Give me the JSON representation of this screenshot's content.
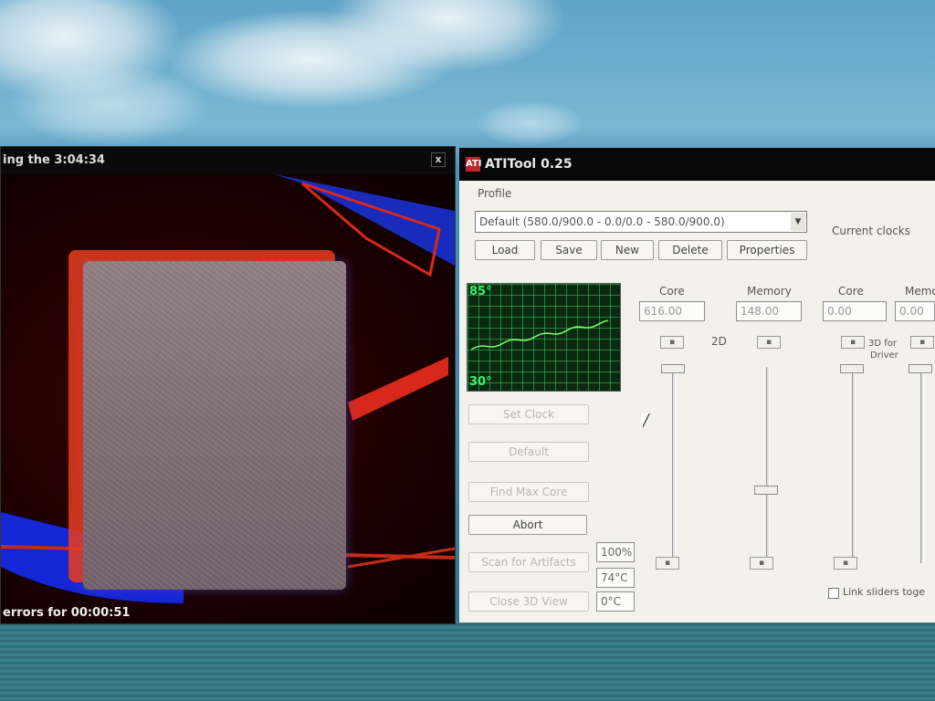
{
  "view_window": {
    "title": "ing the 3:04:34",
    "close_glyph": "x",
    "status": "errors for 00:00:51"
  },
  "ati_window": {
    "title": "ATITool 0.25",
    "logo_glyph": "ATI",
    "profile_label": "Profile",
    "profile_value": "Default (580.0/900.0 - 0.0/0.0 - 580.0/900.0)",
    "profile_arrow": "▼",
    "profile_buttons": [
      "Load",
      "Save",
      "New",
      "Delete",
      "Properties"
    ],
    "current_clocks_label": "Current clocks",
    "graph": {
      "top_label": "85°",
      "bottom_label": "30°"
    },
    "clock_labels": {
      "core": "Core",
      "memory": "Memory",
      "core2": "Core",
      "memory2": "Memory"
    },
    "clock_values": {
      "core": "616.00",
      "memory": "148.00",
      "core2": "0.00",
      "memory2": "0.00"
    },
    "mode_label": "2D",
    "driver_label_top": "3D for",
    "driver_label_bottom": "Driver",
    "action_buttons": [
      {
        "label": "Set Clock",
        "enabled": false
      },
      {
        "label": "Default",
        "enabled": false
      },
      {
        "label": "Find Max Core",
        "enabled": false
      },
      {
        "label": "Abort",
        "enabled": true
      },
      {
        "label": "Scan for Artifacts",
        "enabled": false
      },
      {
        "label": "Close 3D View",
        "enabled": false
      }
    ],
    "readouts": {
      "fan": "100%",
      "gpu_temp": "74°C",
      "ambient_temp": "0°C"
    },
    "link_checkbox_label": "Link sliders toge",
    "small_button_glyph": "▪"
  },
  "graph_series": {
    "type": "line",
    "color": "#7cff6a"
  }
}
